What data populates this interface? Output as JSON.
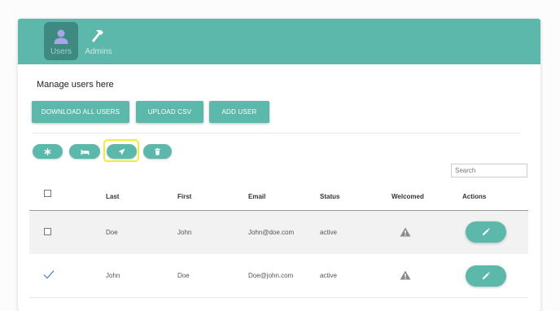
{
  "nav": {
    "tabs": [
      {
        "label": "Users",
        "icon": "user-icon",
        "active": true
      },
      {
        "label": "Admins",
        "icon": "hammer-icon",
        "active": false
      }
    ]
  },
  "page": {
    "title": "Manage users here"
  },
  "toolbar": {
    "download_label": "DOWNLOAD ALL USERS",
    "upload_label": "UPLOAD CSV",
    "add_label": "ADD USER"
  },
  "actions": {
    "icons": [
      "asterisk-icon",
      "bed-icon",
      "send-icon",
      "trash-icon"
    ],
    "highlighted": "send-icon"
  },
  "search": {
    "placeholder": "Search"
  },
  "table": {
    "headers": [
      "Last",
      "First",
      "Email",
      "Status",
      "Welcomed",
      "Actions"
    ],
    "rows": [
      {
        "checked": false,
        "last": "Doe",
        "first": "John",
        "email": "John@doe.com",
        "status": "active",
        "welcomed_icon": "warning-icon"
      },
      {
        "checked": true,
        "last": "John",
        "first": "Doe",
        "email": "Doe@john.com",
        "status": "active",
        "welcomed_icon": "warning-icon"
      }
    ]
  },
  "colors": {
    "accent": "#5db8ac",
    "accent_dark": "#3f8a80",
    "highlight": "#f2ec3a",
    "check": "#3f7fd0"
  }
}
